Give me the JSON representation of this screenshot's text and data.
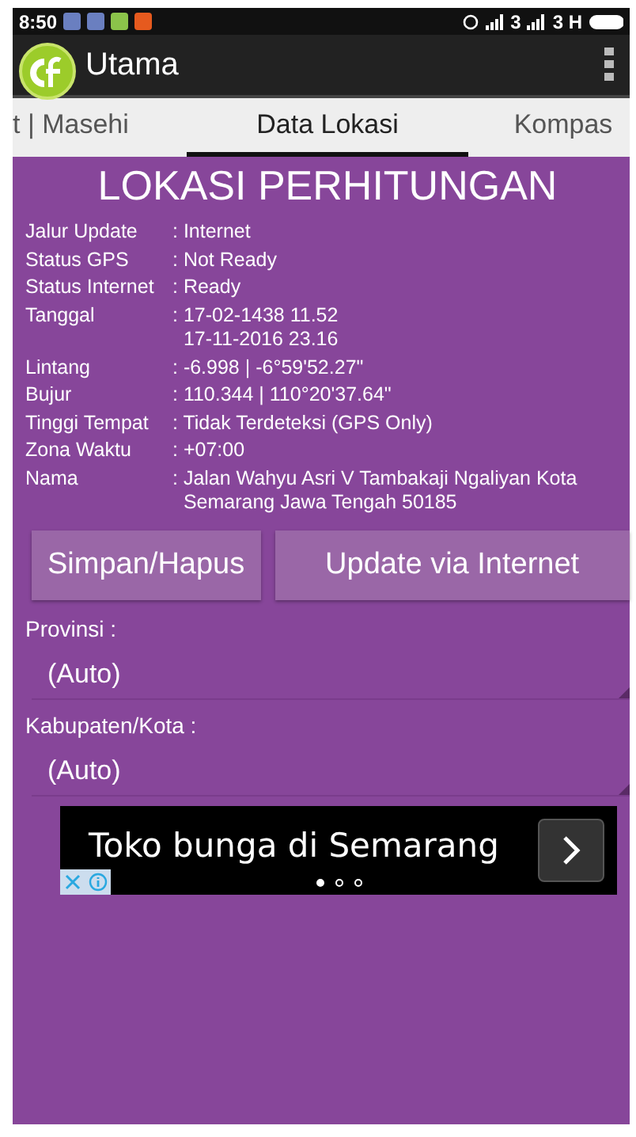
{
  "status_bar": {
    "time": "8:50",
    "signal_1": "3",
    "signal_2": "3 H"
  },
  "app_bar": {
    "title": "Utama"
  },
  "tabs": [
    {
      "label": "t | Masehi",
      "selected": false
    },
    {
      "label": "Data Lokasi",
      "selected": true
    },
    {
      "label": "Kompas",
      "selected": false
    }
  ],
  "panel": {
    "title": "LOKASI PERHITUNGAN",
    "rows": [
      {
        "label": "Jalur Update",
        "lines": [
          ": Internet"
        ]
      },
      {
        "label": "Status GPS",
        "lines": [
          ": Not Ready"
        ]
      },
      {
        "label": "Status Internet",
        "lines": [
          ": Ready"
        ]
      },
      {
        "label": "Tanggal",
        "lines": [
          ": 17-02-1438 11.52",
          "  17-11-2016 23.16"
        ]
      },
      {
        "label": "Lintang",
        "lines": [
          ": -6.998 | -6°59'52.27\""
        ]
      },
      {
        "label": "Bujur",
        "lines": [
          ": 110.344 | 110°20'37.64\""
        ]
      },
      {
        "label": "Tinggi Tempat",
        "lines": [
          ": Tidak Terdeteksi (GPS Only)"
        ]
      },
      {
        "label": "Zona Waktu",
        "lines": [
          ": +07:00"
        ]
      },
      {
        "label": "Nama",
        "lines": [
          ": Jalan Wahyu Asri V Tambakaji Ngaliyan Kota",
          "  Semarang Jawa Tengah 50185"
        ]
      }
    ]
  },
  "buttons": [
    "Simpan/Hapus",
    "Update via Internet"
  ],
  "selects": [
    {
      "label": "Provinsi :",
      "value": "(Auto)"
    },
    {
      "label": "Kabupaten/Kota :",
      "value": "(Auto)"
    }
  ],
  "ad": {
    "text": "Toko bunga di Semarang",
    "pages": [
      {
        "selected": true
      },
      {
        "selected": false
      },
      {
        "selected": false
      }
    ]
  }
}
